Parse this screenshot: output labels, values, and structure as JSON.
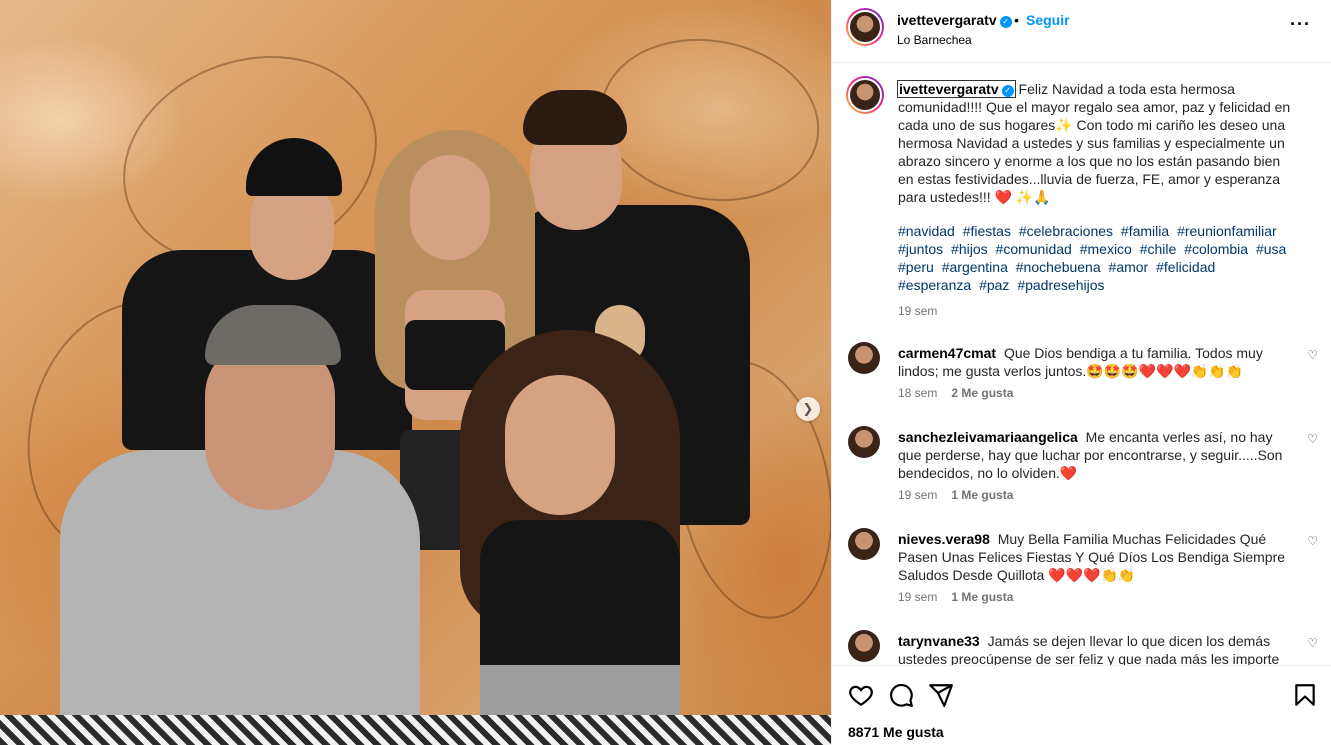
{
  "post": {
    "next_icon": "chevron-right-icon"
  },
  "header": {
    "username": "ivettevergaratv",
    "separator": "•",
    "follow_label": "Seguir",
    "location": "Lo Barnechea",
    "more_label": "···"
  },
  "caption": {
    "username": "ivettevergaratv",
    "text": "Feliz Navidad a toda esta hermosa comunidad!!!! Que el mayor regalo sea amor, paz y felicidad en cada uno de sus hogares✨ Con todo mi cariño les deseo una hermosa Navidad a ustedes y sus familias y especialmente un abrazo sincero y enorme a los que no los están pasando bien en estas festividades...lluvia de fuerza, FE, amor y esperanza para ustedes!!! ❤️ ✨🙏",
    "hashtags": [
      "#navidad",
      "#fiestas",
      "#celebraciones",
      "#familia",
      "#reunionfamiliar",
      "#juntos",
      "#hijos",
      "#comunidad",
      "#mexico",
      "#chile",
      "#colombia",
      "#usa",
      "#peru",
      "#argentina",
      "#nochebuena",
      "#amor",
      "#felicidad",
      "#esperanza",
      "#paz",
      "#padresehijos"
    ],
    "time": "19 sem"
  },
  "comments": [
    {
      "username": "carmen47cmat",
      "text": "Que Dios bendiga a tu familia. Todos muy lindos; me gusta verlos juntos.🤩🤩🤩❤️❤️❤️👏👏👏",
      "time": "18 sem",
      "likes": "2 Me gusta"
    },
    {
      "username": "sanchezleivamariaangelica",
      "text": "Me encanta verles así, no hay que perderse, hay que luchar por encontrarse, y seguir.....Son bendecidos, no lo olviden.❤️",
      "time": "19 sem",
      "likes": "1 Me gusta"
    },
    {
      "username": "nieves.vera98",
      "text": "Muy Bella Familia Muchas Felicidades Qué Pasen Unas Felices Fiestas Y Qué Díos Los Bendiga Siempre Saludos Desde Quillota ❤️❤️❤️👏👏",
      "time": "19 sem",
      "likes": "1 Me gusta"
    },
    {
      "username": "tarynvane33",
      "text": "Jamás se dejen llevar lo que dicen los demás ustedes preocúpense de ser feliz y que nada más les importe",
      "time": "",
      "likes": ""
    }
  ],
  "actions": {
    "icons": [
      "heart-icon",
      "comment-icon",
      "share-icon",
      "bookmark-icon"
    ],
    "likes_count": "8871 Me gusta"
  },
  "colors": {
    "accent": "#0095f6",
    "hashtag": "#00376b",
    "muted": "#737373"
  }
}
